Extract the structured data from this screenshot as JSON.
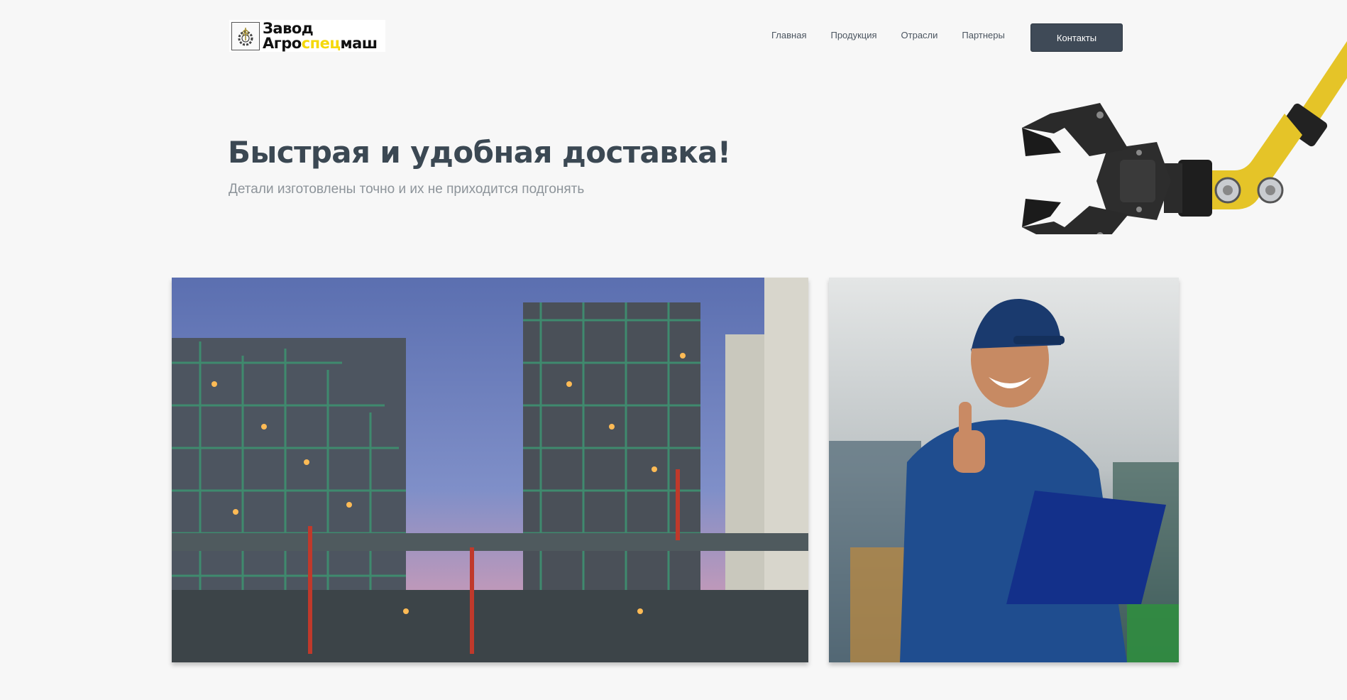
{
  "header": {
    "logo": {
      "line1": "Завод",
      "line2_part1": "Агро",
      "line2_accent": "спец",
      "line2_part2": "маш"
    },
    "nav": [
      "Главная",
      "Продукция",
      "Отрасли",
      "Партнеры"
    ],
    "contact_button": "Контакты"
  },
  "hero": {
    "title": "Быстрая и удобная доставка!",
    "subtitle": "Детали изготовлены точно и их не приходится подгонять"
  },
  "colors": {
    "background": "#f7f7f7",
    "button": "#3f4a57",
    "title": "#3b4853",
    "logo_accent": "#f5d90a",
    "robot_arm": "#e5c428"
  },
  "images": {
    "left": "industrial-plant-photo",
    "right": "worker-thumbs-up-photo",
    "decoration": "robotic-arm-gripper"
  }
}
